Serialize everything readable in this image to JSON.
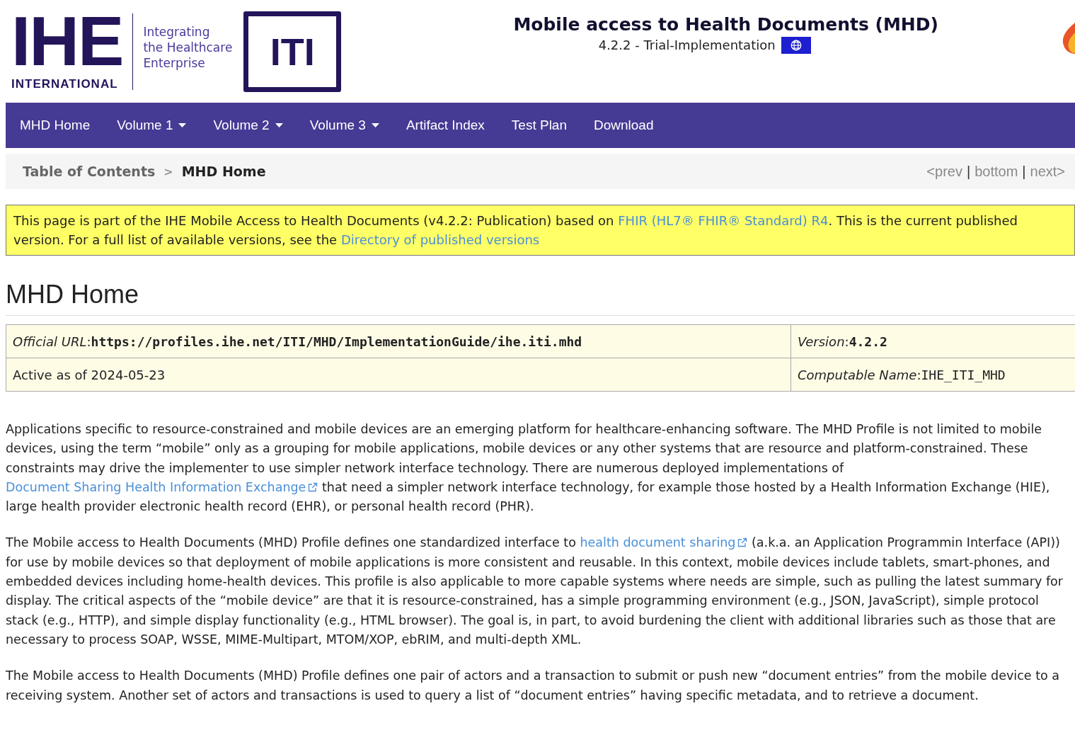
{
  "logo": {
    "letters": "IHE",
    "subtitle": "INTERNATIONAL",
    "tagline": [
      "Integrating",
      "the Healthcare",
      "Enterprise"
    ],
    "domain": "ITI"
  },
  "header": {
    "title": "Mobile access to Health Documents (MHD)",
    "subtitle": "4.2.2 - Trial-Implementation"
  },
  "nav": [
    {
      "label": "MHD Home",
      "dropdown": false
    },
    {
      "label": "Volume 1",
      "dropdown": true
    },
    {
      "label": "Volume 2",
      "dropdown": true
    },
    {
      "label": "Volume 3",
      "dropdown": true
    },
    {
      "label": "Artifact Index",
      "dropdown": false
    },
    {
      "label": "Test Plan",
      "dropdown": false
    },
    {
      "label": "Download",
      "dropdown": false
    }
  ],
  "breadcrumb_separator": ">",
  "pager_separator": "|",
  "breadcrumb": [
    {
      "label": "Table of Contents",
      "current": false
    },
    {
      "label": "MHD Home",
      "current": true
    }
  ],
  "pager": [
    "<prev",
    "bottom",
    "next>"
  ],
  "banner": [
    {
      "text": "This page is part of the IHE Mobile Access to Health Documents (v4.2.2: Publication) based on "
    },
    {
      "text": "FHIR (HL7® FHIR® Standard) R4",
      "link": true
    },
    {
      "text": ". This is the current published version. For a full list of available versions, see the "
    },
    {
      "text": "Directory of published versions",
      "link": true
    }
  ],
  "page_title": "MHD Home",
  "info_table": [
    [
      {
        "label": "*Official URL*:",
        "value": "https://profiles.ihe.net/ITI/MHD/ImplementationGuide/ihe.iti.mhd",
        "kind": "code-bold"
      },
      {
        "label": "*Version*:",
        "value": "4.2.2",
        "kind": "code-bold"
      }
    ],
    [
      {
        "value": "Active as of 2024-05-23",
        "kind": "plain"
      },
      {
        "label": "*Computable Name*:",
        "value": "IHE_ITI_MHD",
        "kind": "code"
      }
    ]
  ],
  "paragraphs": [
    [
      {
        "text": "Applications specific to resource-constrained and mobile devices are an emerging platform for healthcare-enhancing software. The MHD Profile is not limited to mobile devices, using the term “mobile” only as a grouping for mobile applications, mobile devices or any other systems that are resource and platform-constrained. These constraints may drive the implementer to use simpler network interface technology. There are numerous deployed implementations of "
      },
      {
        "text": "Document Sharing Health Information Exchange",
        "link": true,
        "external": true
      },
      {
        "text": " that need a simpler network interface technology, for example those hosted by a Health Information Exchange (HIE), large health provider electronic health record (EHR), or personal health record (PHR)."
      }
    ],
    [
      {
        "text": "The Mobile access to Health Documents (MHD) Profile defines one standardized interface to "
      },
      {
        "text": "health document sharing",
        "link": true,
        "external": true
      },
      {
        "text": " (a.k.a. an Application Programmin Interface (API)) for use by mobile devices so that deployment of mobile applications is more consistent and reusable. In this context, mobile devices include tablets, smart-phones, and embedded devices including home-health devices. This profile is also applicable to more capable systems where needs are simple, such as pulling the latest summary for display. The critical aspects of the “mobile device” are that it is resource-constrained, has a simple programming environment (e.g., JSON, JavaScript), simple protocol stack (e.g., HTTP), and simple display functionality (e.g., HTML browser). The goal is, in part, to avoid burdening the client with additional libraries such as those that are necessary to process SOAP, WSSE, MIME-Multipart, MTOM/XOP, ebRIM, and multi-depth XML."
      }
    ],
    [
      {
        "text": "The Mobile access to Health Documents (MHD) Profile defines one pair of actors and a transaction to submit or push new “document entries” from the mobile device to a receiving system. Another set of actors and transactions is used to query a list of “document entries” having specific metadata, and to retrieve a document."
      }
    ]
  ]
}
